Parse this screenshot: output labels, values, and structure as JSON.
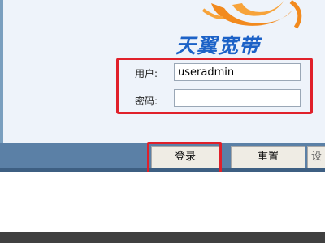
{
  "logo": {
    "text": "天翼宽带",
    "icon_name": "tianyi-swirl-logo-icon",
    "colors": {
      "text": "#1c62c7",
      "swirl": "#f28a1e"
    }
  },
  "login_form": {
    "user_label": "用户:",
    "user_value": "useradmin",
    "password_label": "密码:",
    "password_value": ""
  },
  "buttons": {
    "login_label": "登录",
    "reset_label": "重置",
    "settings_label": "设"
  },
  "colors": {
    "highlight": "#e0202a",
    "bar": "#5b80a6",
    "footer": "#404040"
  }
}
